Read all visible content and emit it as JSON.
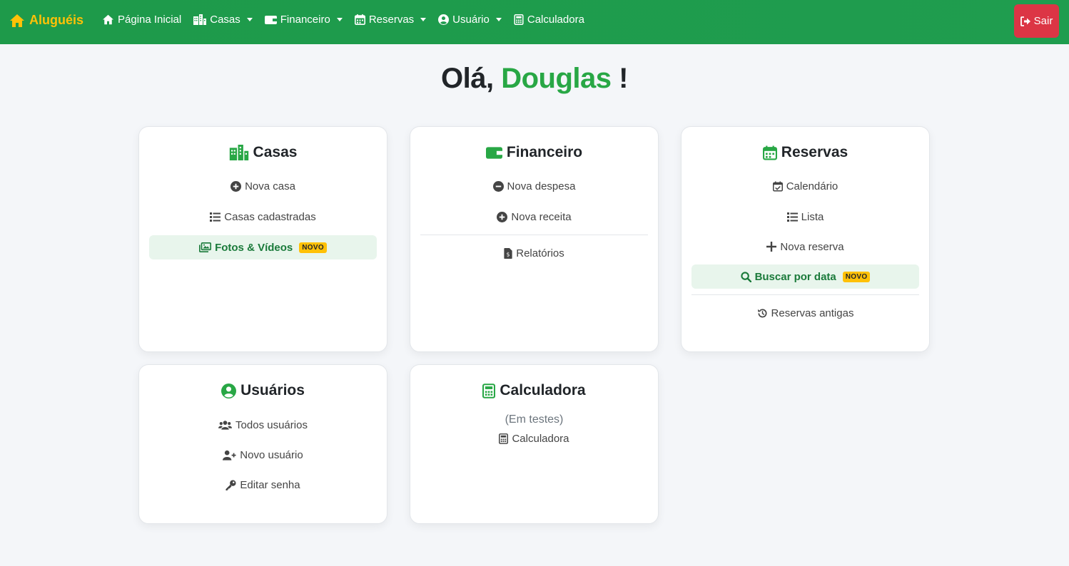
{
  "navbar": {
    "brand": "Aluguéis",
    "items": [
      {
        "label": "Página Inicial",
        "icon": "home-icon",
        "dropdown": false
      },
      {
        "label": "Casas",
        "icon": "city-icon",
        "dropdown": true
      },
      {
        "label": "Financeiro",
        "icon": "wallet-icon",
        "dropdown": true
      },
      {
        "label": "Reservas",
        "icon": "calendar-icon",
        "dropdown": true
      },
      {
        "label": "Usuário",
        "icon": "user-circle-icon",
        "dropdown": true
      },
      {
        "label": "Calculadora",
        "icon": "calculator-icon",
        "dropdown": false
      }
    ],
    "logout": "Sair"
  },
  "greeting": {
    "prefix": "Olá,",
    "name": "Douglas",
    "suffix": "!"
  },
  "cards": {
    "casas": {
      "title": "Casas",
      "links": [
        "Nova casa",
        "Casas cadastradas",
        "Fotos & Vídeos"
      ],
      "badge": "NOVO"
    },
    "financeiro": {
      "title": "Financeiro",
      "links": [
        "Nova despesa",
        "Nova receita",
        "Relatórios"
      ]
    },
    "reservas": {
      "title": "Reservas",
      "links": [
        "Calendário",
        "Lista",
        "Nova reserva",
        "Buscar por data",
        "Reservas antigas"
      ],
      "badge": "NOVO"
    },
    "usuarios": {
      "title": "Usuários",
      "links": [
        "Todos usuários",
        "Novo usuário",
        "Editar senha"
      ]
    },
    "calculadora": {
      "title": "Calculadora",
      "note": "(Em testes)",
      "links": [
        "Calculadora"
      ]
    }
  },
  "colors": {
    "primary": "#28a745",
    "brand": "#ffc107",
    "danger": "#dc3545",
    "highlight_bg": "#e8f5ec"
  }
}
